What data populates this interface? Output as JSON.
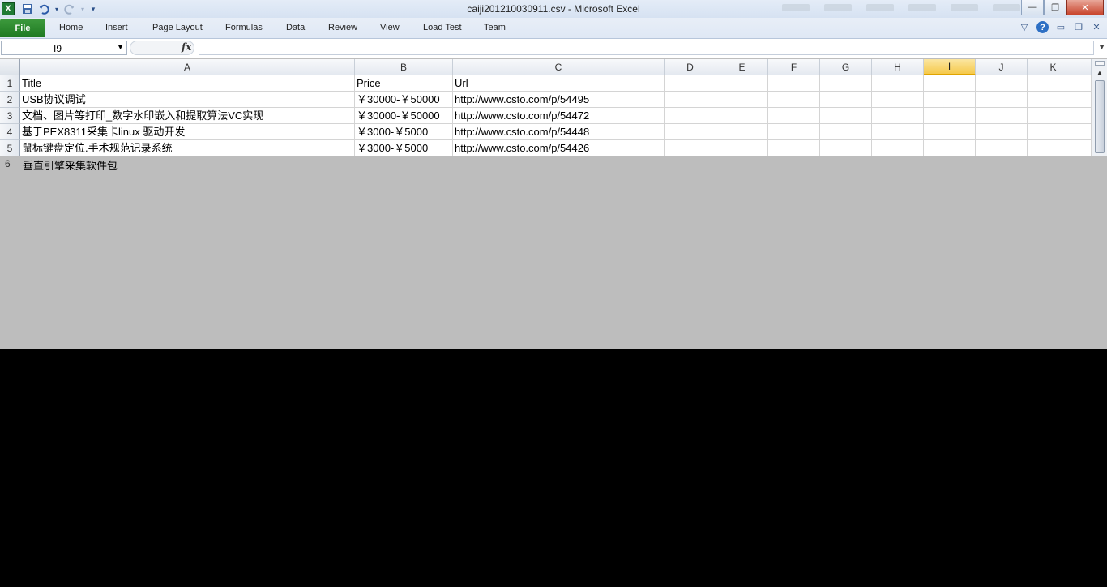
{
  "window": {
    "title": "caiji201210030911.csv - Microsoft Excel",
    "logo_letter": "X"
  },
  "qat": {
    "undo_icon": "undo-icon",
    "redo_icon": "redo-icon",
    "save_icon": "save-icon"
  },
  "ribbon": {
    "file": "File",
    "tabs": [
      "Home",
      "Insert",
      "Page Layout",
      "Formulas",
      "Data",
      "Review",
      "View",
      "Load Test",
      "Team"
    ]
  },
  "formula_bar": {
    "name_box": "I9",
    "fx": "fx",
    "formula": ""
  },
  "grid": {
    "columns": [
      "A",
      "B",
      "C",
      "D",
      "E",
      "F",
      "G",
      "H",
      "I",
      "J",
      "K"
    ],
    "active_column": "I",
    "rows": [
      {
        "num": "1",
        "cells": [
          "Title",
          "Price",
          "Url"
        ]
      },
      {
        "num": "2",
        "cells": [
          "USB协议调试",
          "￥30000-￥50000",
          "http://www.csto.com/p/54495"
        ]
      },
      {
        "num": "3",
        "cells": [
          "文档、图片等打印_数字水印嵌入和提取算法VC实现",
          "￥30000-￥50000",
          "http://www.csto.com/p/54472"
        ]
      },
      {
        "num": "4",
        "cells": [
          "基于PEX8311采集卡linux 驱动开发",
          "￥3000-￥5000",
          "http://www.csto.com/p/54448"
        ]
      },
      {
        "num": "5",
        "cells": [
          "鼠标键盘定位.手术规范记录系统",
          "￥3000-￥5000",
          "http://www.csto.com/p/54426"
        ]
      }
    ],
    "partial_row": {
      "num": "6",
      "text": "垂直引擎采集软件包"
    }
  }
}
